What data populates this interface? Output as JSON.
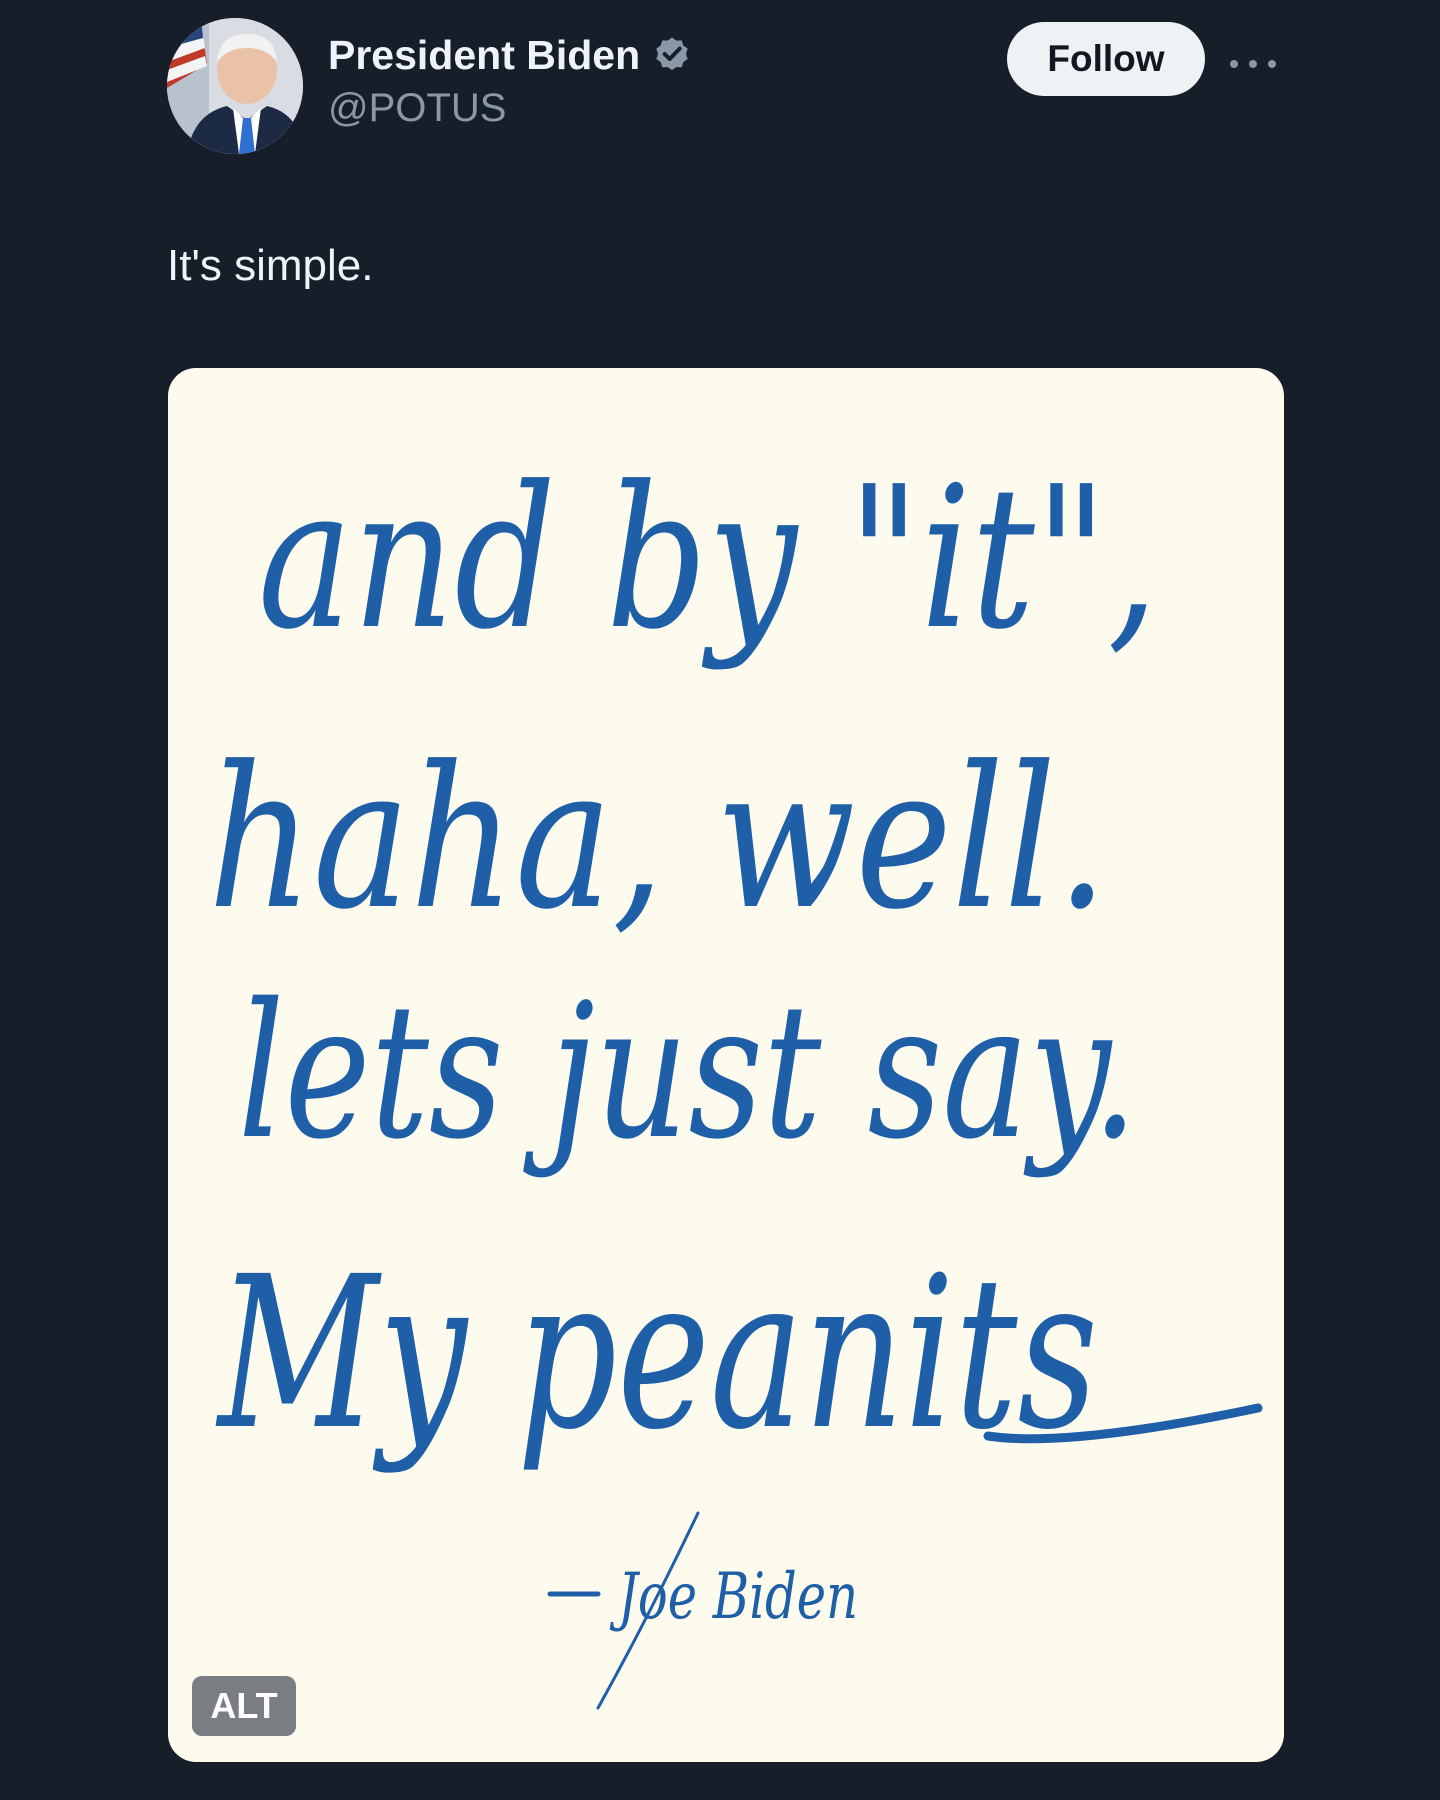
{
  "author": {
    "display_name": "President Biden",
    "handle": "@POTUS",
    "verified": true
  },
  "actions": {
    "follow_label": "Follow",
    "more_icon": "more-icon"
  },
  "tweet": {
    "text": "It's simple."
  },
  "media": {
    "handwritten_lines": [
      "and by \"it\",",
      "haha, well.",
      "lets just say.",
      "My peanits"
    ],
    "signature_text": "Joe Biden",
    "alt_badge": "ALT"
  },
  "colors": {
    "background": "#161e2a",
    "primary_text": "#eef3f7",
    "secondary_text": "#8a97a5",
    "follow_button_bg": "#eef2f5",
    "verified_badge": "#8a97a5",
    "ink": "#1e5fa8",
    "paper": "#fdfaee"
  },
  "icons": {
    "verified": "verified-badge-icon",
    "more": "more-icon"
  }
}
